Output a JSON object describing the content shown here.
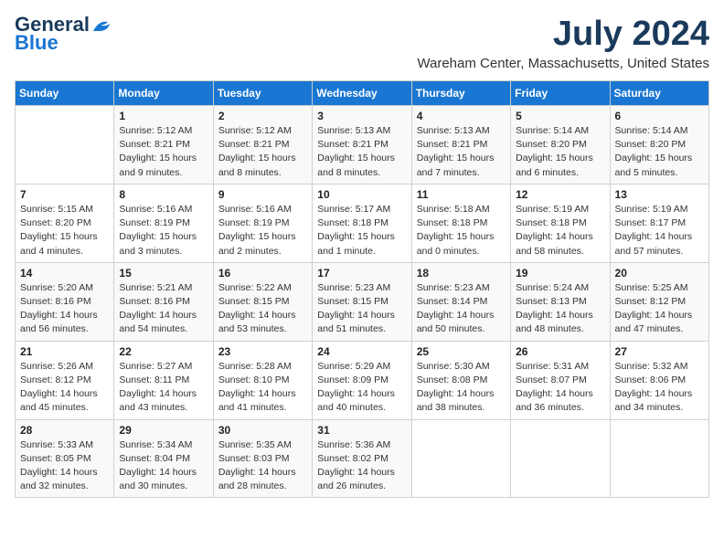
{
  "logo": {
    "line1": "General",
    "line2": "Blue"
  },
  "title": "July 2024",
  "location": "Wareham Center, Massachusetts, United States",
  "days_header": [
    "Sunday",
    "Monday",
    "Tuesday",
    "Wednesday",
    "Thursday",
    "Friday",
    "Saturday"
  ],
  "weeks": [
    [
      {
        "day": "",
        "info": ""
      },
      {
        "day": "1",
        "info": "Sunrise: 5:12 AM\nSunset: 8:21 PM\nDaylight: 15 hours\nand 9 minutes."
      },
      {
        "day": "2",
        "info": "Sunrise: 5:12 AM\nSunset: 8:21 PM\nDaylight: 15 hours\nand 8 minutes."
      },
      {
        "day": "3",
        "info": "Sunrise: 5:13 AM\nSunset: 8:21 PM\nDaylight: 15 hours\nand 8 minutes."
      },
      {
        "day": "4",
        "info": "Sunrise: 5:13 AM\nSunset: 8:21 PM\nDaylight: 15 hours\nand 7 minutes."
      },
      {
        "day": "5",
        "info": "Sunrise: 5:14 AM\nSunset: 8:20 PM\nDaylight: 15 hours\nand 6 minutes."
      },
      {
        "day": "6",
        "info": "Sunrise: 5:14 AM\nSunset: 8:20 PM\nDaylight: 15 hours\nand 5 minutes."
      }
    ],
    [
      {
        "day": "7",
        "info": "Sunrise: 5:15 AM\nSunset: 8:20 PM\nDaylight: 15 hours\nand 4 minutes."
      },
      {
        "day": "8",
        "info": "Sunrise: 5:16 AM\nSunset: 8:19 PM\nDaylight: 15 hours\nand 3 minutes."
      },
      {
        "day": "9",
        "info": "Sunrise: 5:16 AM\nSunset: 8:19 PM\nDaylight: 15 hours\nand 2 minutes."
      },
      {
        "day": "10",
        "info": "Sunrise: 5:17 AM\nSunset: 8:18 PM\nDaylight: 15 hours\nand 1 minute."
      },
      {
        "day": "11",
        "info": "Sunrise: 5:18 AM\nSunset: 8:18 PM\nDaylight: 15 hours\nand 0 minutes."
      },
      {
        "day": "12",
        "info": "Sunrise: 5:19 AM\nSunset: 8:18 PM\nDaylight: 14 hours\nand 58 minutes."
      },
      {
        "day": "13",
        "info": "Sunrise: 5:19 AM\nSunset: 8:17 PM\nDaylight: 14 hours\nand 57 minutes."
      }
    ],
    [
      {
        "day": "14",
        "info": "Sunrise: 5:20 AM\nSunset: 8:16 PM\nDaylight: 14 hours\nand 56 minutes."
      },
      {
        "day": "15",
        "info": "Sunrise: 5:21 AM\nSunset: 8:16 PM\nDaylight: 14 hours\nand 54 minutes."
      },
      {
        "day": "16",
        "info": "Sunrise: 5:22 AM\nSunset: 8:15 PM\nDaylight: 14 hours\nand 53 minutes."
      },
      {
        "day": "17",
        "info": "Sunrise: 5:23 AM\nSunset: 8:15 PM\nDaylight: 14 hours\nand 51 minutes."
      },
      {
        "day": "18",
        "info": "Sunrise: 5:23 AM\nSunset: 8:14 PM\nDaylight: 14 hours\nand 50 minutes."
      },
      {
        "day": "19",
        "info": "Sunrise: 5:24 AM\nSunset: 8:13 PM\nDaylight: 14 hours\nand 48 minutes."
      },
      {
        "day": "20",
        "info": "Sunrise: 5:25 AM\nSunset: 8:12 PM\nDaylight: 14 hours\nand 47 minutes."
      }
    ],
    [
      {
        "day": "21",
        "info": "Sunrise: 5:26 AM\nSunset: 8:12 PM\nDaylight: 14 hours\nand 45 minutes."
      },
      {
        "day": "22",
        "info": "Sunrise: 5:27 AM\nSunset: 8:11 PM\nDaylight: 14 hours\nand 43 minutes."
      },
      {
        "day": "23",
        "info": "Sunrise: 5:28 AM\nSunset: 8:10 PM\nDaylight: 14 hours\nand 41 minutes."
      },
      {
        "day": "24",
        "info": "Sunrise: 5:29 AM\nSunset: 8:09 PM\nDaylight: 14 hours\nand 40 minutes."
      },
      {
        "day": "25",
        "info": "Sunrise: 5:30 AM\nSunset: 8:08 PM\nDaylight: 14 hours\nand 38 minutes."
      },
      {
        "day": "26",
        "info": "Sunrise: 5:31 AM\nSunset: 8:07 PM\nDaylight: 14 hours\nand 36 minutes."
      },
      {
        "day": "27",
        "info": "Sunrise: 5:32 AM\nSunset: 8:06 PM\nDaylight: 14 hours\nand 34 minutes."
      }
    ],
    [
      {
        "day": "28",
        "info": "Sunrise: 5:33 AM\nSunset: 8:05 PM\nDaylight: 14 hours\nand 32 minutes."
      },
      {
        "day": "29",
        "info": "Sunrise: 5:34 AM\nSunset: 8:04 PM\nDaylight: 14 hours\nand 30 minutes."
      },
      {
        "day": "30",
        "info": "Sunrise: 5:35 AM\nSunset: 8:03 PM\nDaylight: 14 hours\nand 28 minutes."
      },
      {
        "day": "31",
        "info": "Sunrise: 5:36 AM\nSunset: 8:02 PM\nDaylight: 14 hours\nand 26 minutes."
      },
      {
        "day": "",
        "info": ""
      },
      {
        "day": "",
        "info": ""
      },
      {
        "day": "",
        "info": ""
      }
    ]
  ]
}
